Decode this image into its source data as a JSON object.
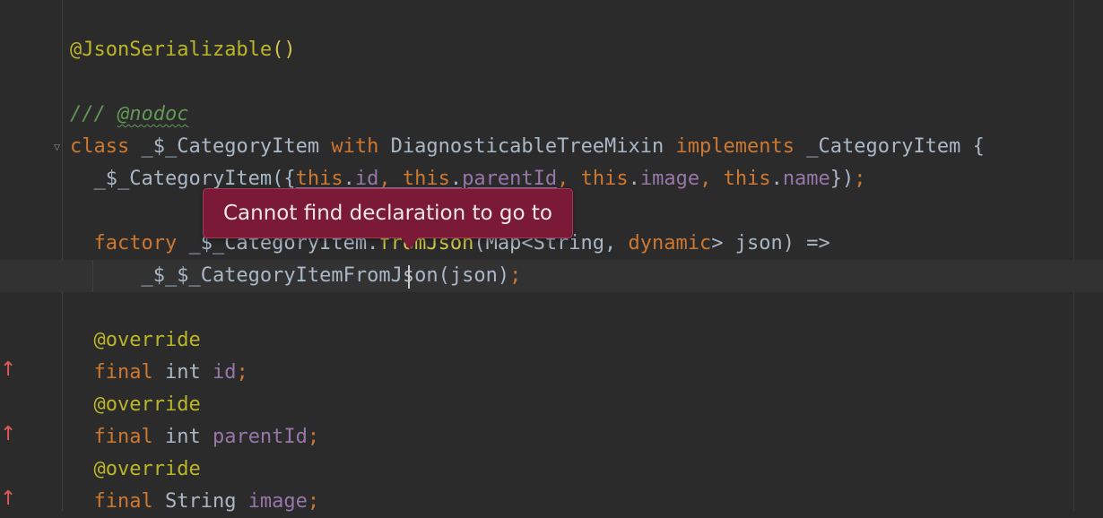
{
  "editor": {
    "lines": [
      {
        "id": "annotation-json-serializable",
        "tokens": [
          {
            "text": "@",
            "cls": "ann"
          },
          {
            "text": "JsonSerializable",
            "cls": "ann"
          },
          {
            "text": "()",
            "cls": "paren-y"
          }
        ]
      },
      {
        "id": "blank-1",
        "tokens": []
      },
      {
        "id": "doc-comment-nodoc",
        "tokens": [
          {
            "text": "/// ",
            "cls": "doc"
          },
          {
            "text": "@nodoc",
            "cls": "docsq"
          }
        ]
      },
      {
        "id": "class-declaration",
        "tokens": [
          {
            "text": "class ",
            "cls": "kw"
          },
          {
            "text": "_$_CategoryItem ",
            "cls": "ty"
          },
          {
            "text": "with ",
            "cls": "kw"
          },
          {
            "text": "DiagnosticableTreeMixin ",
            "cls": "ty"
          },
          {
            "text": "implements ",
            "cls": "kw"
          },
          {
            "text": "_CategoryItem {",
            "cls": "ty"
          }
        ]
      },
      {
        "id": "constructor",
        "tokens": [
          {
            "text": "  _$_CategoryItem({",
            "cls": "ty"
          },
          {
            "text": "this",
            "cls": "kw under"
          },
          {
            "text": ".",
            "cls": "ty under"
          },
          {
            "text": "id",
            "cls": "fld under"
          },
          {
            "text": ", ",
            "cls": "kw under"
          },
          {
            "text": "this",
            "cls": "kw under"
          },
          {
            "text": ".",
            "cls": "ty under"
          },
          {
            "text": "parentId",
            "cls": "fld under"
          },
          {
            "text": ", ",
            "cls": "kw"
          },
          {
            "text": "this",
            "cls": "kw"
          },
          {
            "text": ".",
            "cls": "ty"
          },
          {
            "text": "image",
            "cls": "fld"
          },
          {
            "text": ", ",
            "cls": "kw"
          },
          {
            "text": "this",
            "cls": "kw"
          },
          {
            "text": ".",
            "cls": "ty"
          },
          {
            "text": "name",
            "cls": "fld"
          },
          {
            "text": "})",
            "cls": "ty"
          },
          {
            "text": ";",
            "cls": "kw"
          }
        ]
      },
      {
        "id": "blank-2",
        "tokens": []
      },
      {
        "id": "factory-declaration",
        "tokens": [
          {
            "text": "  factory ",
            "cls": "kw"
          },
          {
            "text": "_$_CategoryItem.",
            "cls": "ty"
          },
          {
            "text": "fromJson",
            "cls": "paren-y"
          },
          {
            "text": "(Map<String, ",
            "cls": "ty"
          },
          {
            "text": "dynamic",
            "cls": "kw"
          },
          {
            "text": "> json) =>",
            "cls": "ty"
          }
        ]
      },
      {
        "id": "factory-body",
        "tokens": [
          {
            "text": "      _$_$_CategoryItemFromJson(json)",
            "cls": "ty"
          },
          {
            "text": ";",
            "cls": "kw"
          }
        ]
      },
      {
        "id": "blank-3",
        "tokens": []
      },
      {
        "id": "override-id",
        "tokens": [
          {
            "text": "  @",
            "cls": "ann"
          },
          {
            "text": "override",
            "cls": "ann"
          }
        ]
      },
      {
        "id": "field-id",
        "tokens": [
          {
            "text": "  final ",
            "cls": "kw"
          },
          {
            "text": "int ",
            "cls": "ty"
          },
          {
            "text": "id",
            "cls": "fld"
          },
          {
            "text": ";",
            "cls": "kw"
          }
        ]
      },
      {
        "id": "override-parent-id",
        "tokens": [
          {
            "text": "  @",
            "cls": "ann"
          },
          {
            "text": "override",
            "cls": "ann"
          }
        ]
      },
      {
        "id": "field-parent-id",
        "tokens": [
          {
            "text": "  final ",
            "cls": "kw"
          },
          {
            "text": "int ",
            "cls": "ty"
          },
          {
            "text": "parentId",
            "cls": "fld"
          },
          {
            "text": ";",
            "cls": "kw"
          }
        ]
      },
      {
        "id": "override-image",
        "tokens": [
          {
            "text": "  @",
            "cls": "ann"
          },
          {
            "text": "override",
            "cls": "ann"
          }
        ]
      },
      {
        "id": "field-image",
        "tokens": [
          {
            "text": "  final ",
            "cls": "kw"
          },
          {
            "text": "String ",
            "cls": "ty"
          },
          {
            "text": "image",
            "cls": "fld"
          },
          {
            "text": ";",
            "cls": "kw"
          }
        ]
      }
    ],
    "gutter_icons": [
      "implements-arrow-icon",
      "implements-arrow-icon",
      "implements-arrow-icon"
    ],
    "fold_icon": "fold-marker-icon"
  },
  "tooltip": {
    "message": "Cannot find declaration to go to"
  },
  "colors": {
    "background": "#2b2b2b",
    "keyword": "#cc7832",
    "annotation": "#bbb529",
    "field": "#9876aa",
    "doc_comment": "#629755",
    "tooltip_bg": "#7a1a36"
  }
}
